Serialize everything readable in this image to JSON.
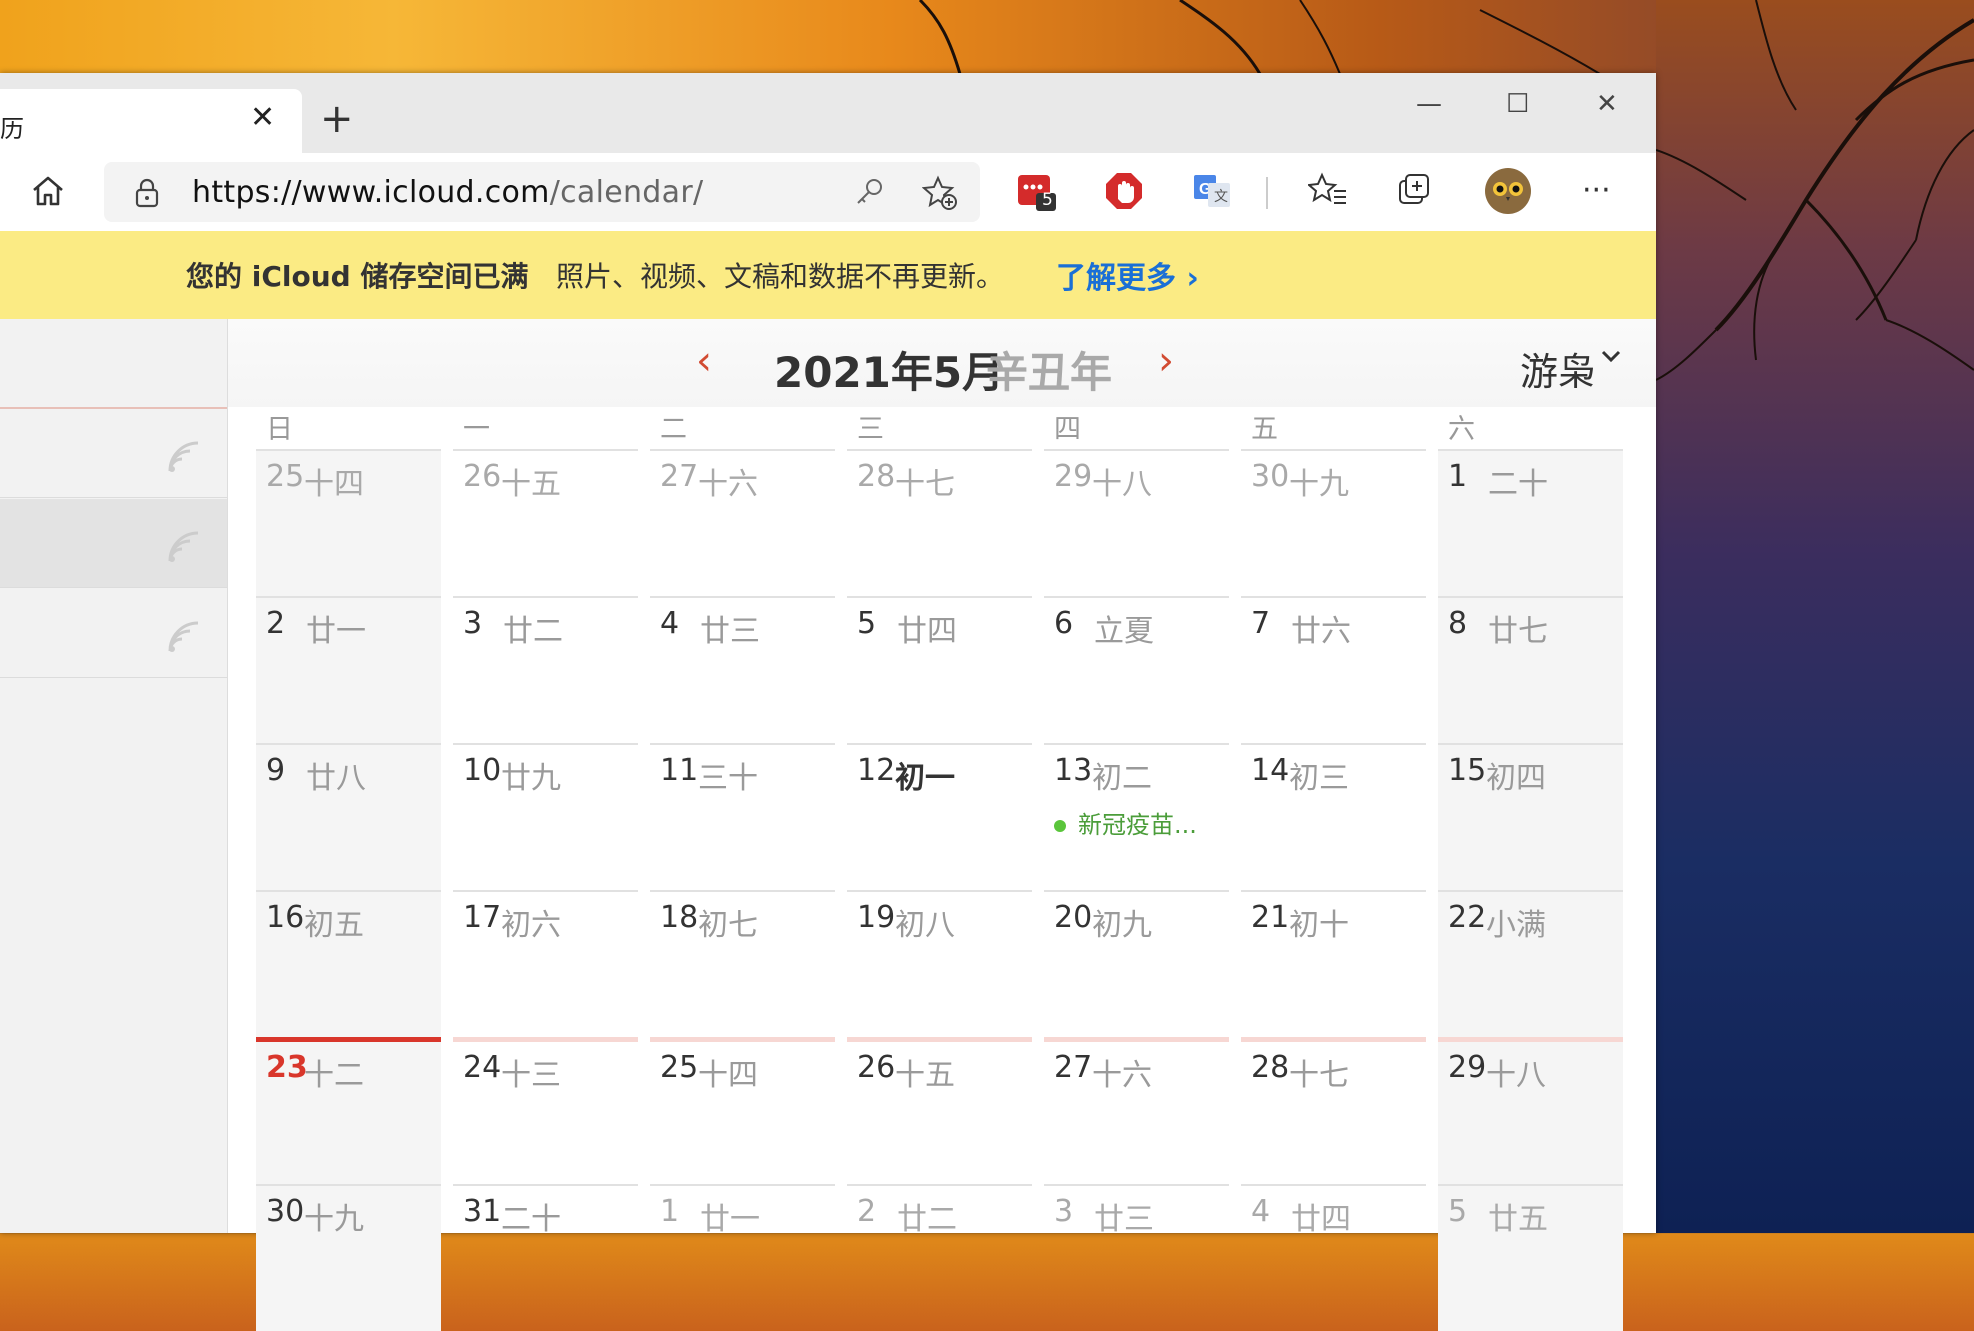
{
  "browser": {
    "tab_title": "历",
    "tab_close": "✕",
    "new_tab": "+",
    "window_controls": {
      "minimize": "—",
      "maximize": "☐",
      "close": "✕"
    },
    "url_host": "https://www.icloud.com",
    "url_path": "/calendar/",
    "extension_badge": "5",
    "more": "···",
    "icons": [
      "home-icon",
      "lock-icon",
      "key-icon",
      "favorite-add-icon",
      "extension-icon",
      "adblock-icon",
      "translate-icon",
      "favorites-icon",
      "collections-icon",
      "profile-avatar",
      "more-icon"
    ]
  },
  "banner": {
    "bold": "您的 iCloud 储存空间已满",
    "message": "照片、视频、文稿和数据不再更新。",
    "link": "了解更多 ›"
  },
  "calendar": {
    "month": "2021年5月",
    "lunar_year": "辛丑年",
    "user": "游枭",
    "prev": "‹",
    "next": "›",
    "weekdays": [
      "日",
      "一",
      "二",
      "三",
      "四",
      "五",
      "六"
    ],
    "weeks": [
      [
        [
          "25",
          "十四"
        ],
        [
          "26",
          "十五"
        ],
        [
          "27",
          "十六"
        ],
        [
          "28",
          "十七"
        ],
        [
          "29",
          "十八"
        ],
        [
          "30",
          "十九"
        ],
        [
          "1",
          "二十"
        ]
      ],
      [
        [
          "2",
          "廿一"
        ],
        [
          "3",
          "廿二"
        ],
        [
          "4",
          "廿三"
        ],
        [
          "5",
          "廿四"
        ],
        [
          "6",
          "立夏"
        ],
        [
          "7",
          "廿六"
        ],
        [
          "8",
          "廿七"
        ]
      ],
      [
        [
          "9",
          "廿八"
        ],
        [
          "10",
          "廿九"
        ],
        [
          "11",
          "三十"
        ],
        [
          "12",
          "初一"
        ],
        [
          "13",
          "初二"
        ],
        [
          "14",
          "初三"
        ],
        [
          "15",
          "初四"
        ]
      ],
      [
        [
          "16",
          "初五"
        ],
        [
          "17",
          "初六"
        ],
        [
          "18",
          "初七"
        ],
        [
          "19",
          "初八"
        ],
        [
          "20",
          "初九"
        ],
        [
          "21",
          "初十"
        ],
        [
          "22",
          "小满"
        ]
      ],
      [
        [
          "23",
          "十二"
        ],
        [
          "24",
          "十三"
        ],
        [
          "25",
          "十四"
        ],
        [
          "26",
          "十五"
        ],
        [
          "27",
          "十六"
        ],
        [
          "28",
          "十七"
        ],
        [
          "29",
          "十八"
        ]
      ],
      [
        [
          "30",
          "十九"
        ],
        [
          "31",
          "二十"
        ],
        [
          "1",
          "廿一"
        ],
        [
          "2",
          "廿二"
        ],
        [
          "3",
          "廿三"
        ],
        [
          "4",
          "廿四"
        ],
        [
          "5",
          "廿五"
        ]
      ]
    ],
    "event": {
      "title": "新冠疫苗...",
      "date": "13",
      "color": "#5ac53b"
    },
    "today": "23",
    "accent": "#d9362b"
  }
}
